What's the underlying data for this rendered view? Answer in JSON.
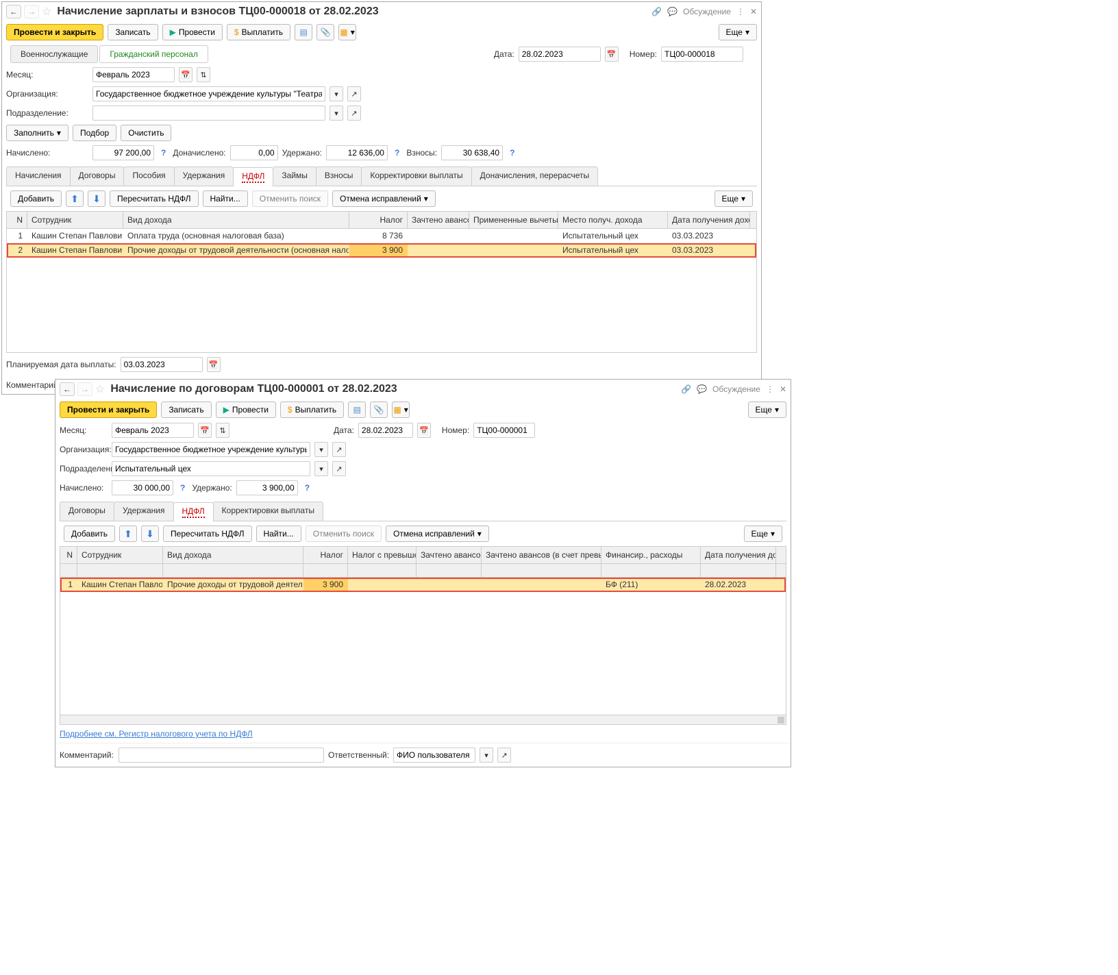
{
  "w1": {
    "title": "Начисление зарплаты и взносов ТЦ00-000018 от 28.02.2023",
    "discuss": "Обсуждение",
    "toolbar": {
      "post_close": "Провести и закрыть",
      "save": "Записать",
      "post": "Провести",
      "pay": "Выплатить",
      "more": "Еще"
    },
    "cat_tabs": {
      "mil": "Военнослужащие",
      "civ": "Гражданский персонал"
    },
    "date_lbl": "Дата:",
    "date_val": "28.02.2023",
    "num_lbl": "Номер:",
    "num_val": "ТЦ00-000018",
    "month_lbl": "Месяц:",
    "month_val": "Февраль 2023",
    "org_lbl": "Организация:",
    "org_val": "Государственное бюджетное учреждение культуры \"Театральный центр\"",
    "dept_lbl": "Подразделение:",
    "dept_val": "",
    "fill": "Заполнить",
    "pick": "Подбор",
    "clear": "Очистить",
    "totals": {
      "accr_lbl": "Начислено:",
      "accr": "97 200,00",
      "add_lbl": "Доначислено:",
      "add": "0,00",
      "hold_lbl": "Удержано:",
      "hold": "12 636,00",
      "contr_lbl": "Взносы:",
      "contr": "30 638,40"
    },
    "tabs": [
      "Начисления",
      "Договоры",
      "Пособия",
      "Удержания",
      "НДФЛ",
      "Займы",
      "Взносы",
      "Корректировки выплаты",
      "Доначисления, перерасчеты"
    ],
    "sub": {
      "add": "Добавить",
      "recalc": "Пересчитать НДФЛ",
      "find": "Найти...",
      "cancel_find": "Отменить поиск",
      "cancel_fix": "Отмена исправлений",
      "more": "Еще"
    },
    "cols": {
      "n": "N",
      "emp": "Сотрудник",
      "inc": "Вид дохода",
      "tax": "Налог",
      "adv": "Зачтено авансов",
      "ded": "Примененные вычеты",
      "place": "Место получ. дохода",
      "date": "Дата получения дохода"
    },
    "rows": [
      {
        "n": "1",
        "emp": "Кашин Степан Павлович",
        "inc": "Оплата труда (основная налоговая база)",
        "tax": "8 736",
        "adv": "",
        "ded": "",
        "place": "Испытательный цех",
        "date": "03.03.2023"
      },
      {
        "n": "2",
        "emp": "Кашин Степан Павлович",
        "inc": "Прочие доходы от трудовой деятельности (основная налоговая база)",
        "tax": "3 900",
        "adv": "",
        "ded": "",
        "place": "Испытательный цех",
        "date": "03.03.2023"
      }
    ],
    "plan_lbl": "Планируемая дата выплаты:",
    "plan_val": "03.03.2023",
    "comment_lbl": "Комментарий:"
  },
  "w2": {
    "title": "Начисление по договорам ТЦ00-000001 от 28.02.2023",
    "discuss": "Обсуждение",
    "toolbar": {
      "post_close": "Провести и закрыть",
      "save": "Записать",
      "post": "Провести",
      "pay": "Выплатить",
      "more": "Еще"
    },
    "month_lbl": "Месяц:",
    "month_val": "Февраль 2023",
    "date_lbl": "Дата:",
    "date_val": "28.02.2023",
    "num_lbl": "Номер:",
    "num_val": "ТЦ00-000001",
    "org_lbl": "Организация:",
    "org_val": "Государственное бюджетное учреждение культуры \"Театраль",
    "dept_lbl": "Подразделение:",
    "dept_val": "Испытательный цех",
    "accr_lbl": "Начислено:",
    "accr": "30 000,00",
    "hold_lbl": "Удержано:",
    "hold": "3 900,00",
    "tabs": [
      "Договоры",
      "Удержания",
      "НДФЛ",
      "Корректировки выплаты"
    ],
    "sub": {
      "add": "Добавить",
      "recalc": "Пересчитать НДФЛ",
      "find": "Найти...",
      "cancel_find": "Отменить поиск",
      "cancel_fix": "Отмена исправлений",
      "more": "Еще"
    },
    "cols": {
      "n": "N",
      "emp": "Сотрудник",
      "inc": "Вид дохода",
      "tax": "Налог",
      "tax2": "Налог с превышения",
      "adv": "Зачтено авансов",
      "adv2": "Зачтено авансов (в счет превышения)",
      "fin": "Финансир., расходы",
      "date": "Дата получения дохода"
    },
    "rows": [
      {
        "n": "1",
        "emp": "Кашин Степан Павлович",
        "inc": "Прочие доходы от трудовой деятельности...",
        "tax": "3 900",
        "tax2": "",
        "adv": "",
        "adv2": "",
        "fin": "БФ (211)",
        "date": "28.02.2023"
      }
    ],
    "link": "Подробнее см. Регистр налогового учета по НДФЛ",
    "comment_lbl": "Комментарий:",
    "resp_lbl": "Ответственный:",
    "resp_val": "ФИО пользователя"
  }
}
